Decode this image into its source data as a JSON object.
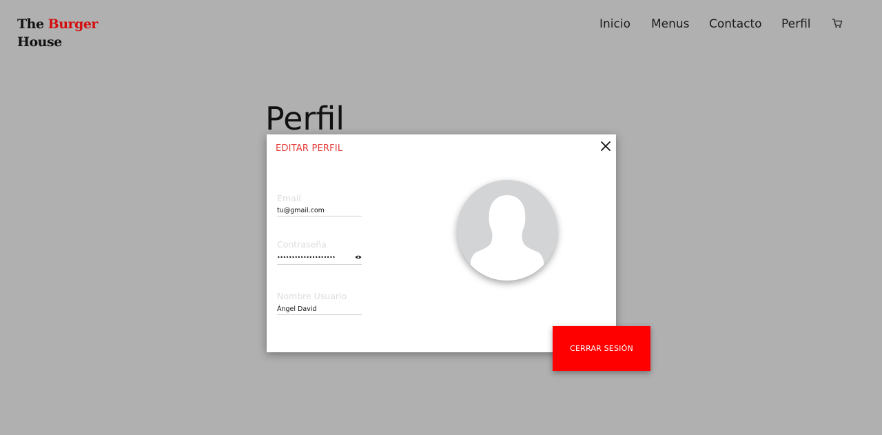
{
  "logo": {
    "word1": "The",
    "word2": "Burger",
    "word3": "House"
  },
  "nav": {
    "items": [
      "Inicio",
      "Menus",
      "Contacto",
      "Perfil"
    ],
    "cart_icon": "cart-icon"
  },
  "page": {
    "title": "Perfil"
  },
  "modal": {
    "title": "EDITAR PERFIL",
    "close_icon": "close-icon",
    "fields": {
      "email": {
        "label": "Email",
        "value": "tu@gmail.com"
      },
      "password": {
        "label": "Contraseña",
        "value": "••••••••••••••••••••",
        "toggle_icon": "eye-icon"
      },
      "username": {
        "label": "Nombre Usuario",
        "value": "Ángel David"
      }
    },
    "avatar_icon": "user-silhouette-icon"
  },
  "actions": {
    "logout_label": "CERRAR SESIÓN"
  },
  "colors": {
    "background": "#b0b0b0",
    "brand_red": "#d40d0d",
    "accent_red": "#e53935",
    "button_red": "#ff0000",
    "avatar_bg": "#d2d4d6"
  }
}
